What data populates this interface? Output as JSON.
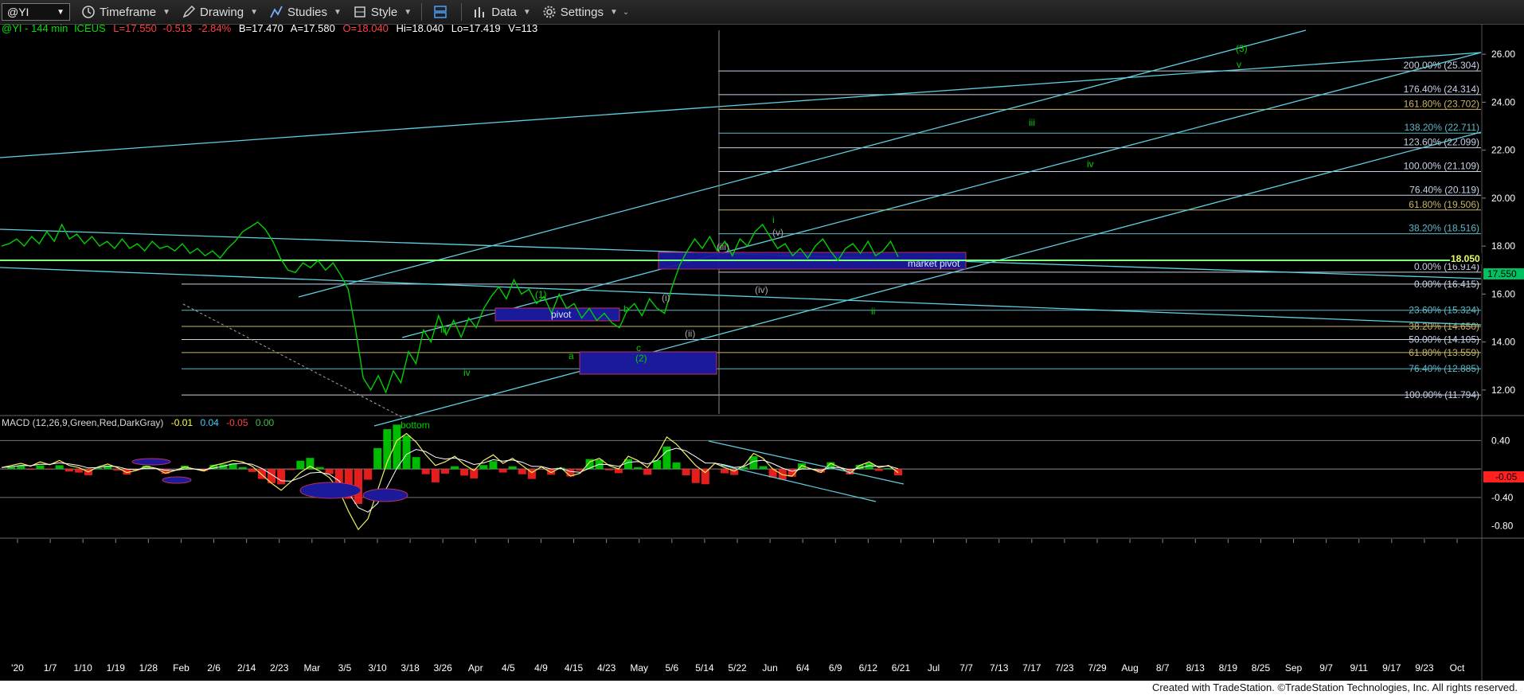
{
  "toolbar": {
    "symbol": "@YI",
    "timeframe_label": "Timeframe",
    "drawing_label": "Drawing",
    "studies_label": "Studies",
    "style_label": "Style",
    "data_label": "Data",
    "settings_label": "Settings"
  },
  "header": {
    "symbol": "@YI",
    "interval": "144 min",
    "exchange": "ICEUS",
    "last": "L=17.550",
    "change": "-0.513",
    "change_pct": "-2.84%",
    "bid": "B=17.470",
    "ask": "A=17.580",
    "open": "O=18.040",
    "high": "Hi=18.040",
    "low": "Lo=17.419",
    "volume": "V=113"
  },
  "macd_header": {
    "name": "MACD (12,26,9,Green,Red,DarkGray)",
    "v1": "-0.01",
    "v2": "0.04",
    "v3": "-0.05",
    "v4": "0.00"
  },
  "footer": "Created with TradeStation. ©TradeStation Technologies, Inc. All rights reserved.",
  "colors": {
    "up": "#00d000",
    "line": "#00ff00",
    "fib": "#cfd8e8",
    "channel": "#5fd0e0",
    "box": "#1a1a9a",
    "price_tag": "#00c060",
    "neg": "#ff2020"
  },
  "chart_data": {
    "type": "line",
    "price_axis": {
      "min": 11,
      "max": 27,
      "ticks": [
        "26.00",
        "24.00",
        "22.00",
        "20.00",
        "18.00",
        "16.00",
        "14.00",
        "12.00"
      ],
      "tick_values": [
        26,
        24,
        22,
        20,
        18,
        16,
        14,
        12
      ]
    },
    "macd_axis": {
      "ticks": [
        "0.40",
        "-0.40",
        "-0.80"
      ],
      "tick_values": [
        0.4,
        -0.4,
        -0.8
      ],
      "min": -0.95,
      "max": 0.55
    },
    "x_labels": [
      "'20",
      "1/7",
      "1/10",
      "1/19",
      "1/28",
      "Feb",
      "2/6",
      "2/14",
      "2/23",
      "Mar",
      "3/5",
      "3/10",
      "3/18",
      "3/26",
      "Apr",
      "4/5",
      "4/9",
      "4/15",
      "4/23",
      "May",
      "5/6",
      "5/14",
      "5/22",
      "Jun",
      "6/4",
      "6/9",
      "6/12",
      "6/21",
      "Jul",
      "7/7",
      "7/13",
      "7/17",
      "7/23",
      "7/29",
      "Aug",
      "8/7",
      "8/13",
      "8/19",
      "8/25",
      "Sep",
      "9/7",
      "9/11",
      "9/17",
      "9/23",
      "Oct"
    ],
    "price_tags": {
      "last": "17.550",
      "pivot_level": "18.050",
      "macd_last": "-0.05"
    },
    "price_series": {
      "name": "@YI",
      "values": [
        18.0,
        18.1,
        18.3,
        18.0,
        18.4,
        18.1,
        18.6,
        18.2,
        18.9,
        18.3,
        18.5,
        18.1,
        18.4,
        18.0,
        18.2,
        17.9,
        18.3,
        17.9,
        18.1,
        17.8,
        18.2,
        17.9,
        18.0,
        17.8,
        18.1,
        17.7,
        17.9,
        17.6,
        17.8,
        17.5,
        17.9,
        18.2,
        18.6,
        18.8,
        19.0,
        18.7,
        18.2,
        17.5,
        17.0,
        16.9,
        17.3,
        17.1,
        17.4,
        17.0,
        17.3,
        16.8,
        16.2,
        14.5,
        12.5,
        12.0,
        12.6,
        11.9,
        12.8,
        12.3,
        13.6,
        13.1,
        14.5,
        14.0,
        15.1,
        14.3,
        14.9,
        14.2,
        15.0,
        14.6,
        15.4,
        15.9,
        16.3,
        15.8,
        16.6,
        16.0,
        16.2,
        15.6,
        15.9,
        15.2,
        16.0,
        15.4,
        15.6,
        15.0,
        15.4,
        14.9,
        15.2,
        14.8,
        14.6,
        15.3,
        15.6,
        15.1,
        15.8,
        15.4,
        15.2,
        16.3,
        17.2,
        17.8,
        18.3,
        17.9,
        18.4,
        17.8,
        18.2,
        17.6,
        18.3,
        18.0,
        18.6,
        18.9,
        18.4,
        17.9,
        18.1,
        17.6,
        17.9,
        17.5,
        18.0,
        18.3,
        17.8,
        17.4,
        17.9,
        18.1,
        17.7,
        18.2,
        17.6,
        17.8,
        18.2,
        17.55
      ],
      "start": "2019-12-26",
      "end": "2020-06-24"
    },
    "macd_series": {
      "name": "MACD",
      "values": [
        0.02,
        0.05,
        0.08,
        0.04,
        0.1,
        0.06,
        0.12,
        0.05,
        0.02,
        -0.04,
        0.03,
        0.07,
        0.02,
        -0.05,
        -0.02,
        0.04,
        0.01,
        -0.06,
        -0.02,
        0.03,
        0.0,
        -0.03,
        0.05,
        0.08,
        0.12,
        0.1,
        0.04,
        -0.08,
        -0.2,
        -0.3,
        -0.18,
        -0.05,
        0.04,
        -0.03,
        -0.12,
        -0.3,
        -0.6,
        -0.85,
        -0.7,
        -0.3,
        0.1,
        0.4,
        0.5,
        0.38,
        0.2,
        0.05,
        0.1,
        0.18,
        0.06,
        -0.02,
        0.12,
        0.2,
        0.08,
        0.15,
        0.05,
        -0.05,
        0.03,
        -0.05,
        0.02,
        -0.1,
        -0.06,
        0.1,
        0.15,
        0.05,
        0.0,
        0.18,
        0.12,
        0.02,
        0.2,
        0.45,
        0.35,
        0.2,
        0.05,
        -0.05,
        0.08,
        0.02,
        -0.03,
        0.05,
        0.22,
        0.15,
        0.0,
        -0.08,
        -0.1,
        0.05,
        0.0,
        -0.05,
        0.08,
        0.02,
        -0.06,
        0.05,
        0.1,
        0.02,
        0.05,
        -0.05
      ]
    },
    "fib_right": [
      {
        "label": "200.00% (25.304)",
        "value": 25.304,
        "color": "#c8d2e6"
      },
      {
        "label": "176.40% (24.314)",
        "value": 24.314,
        "color": "#c8d2e6"
      },
      {
        "label": "161.80% (23.702)",
        "value": 23.702,
        "color": "#c8b468"
      },
      {
        "label": "138.20% (22.711)",
        "value": 22.711,
        "color": "#5fb8c8"
      },
      {
        "label": "123.60% (22.099)",
        "value": 22.099,
        "color": "#c8d2e6"
      },
      {
        "label": "100.00% (21.109)",
        "value": 21.109,
        "color": "#c8d2e6"
      },
      {
        "label": "76.40% (20.119)",
        "value": 20.119,
        "color": "#c8d2e6"
      },
      {
        "label": "61.80% (19.506)",
        "value": 19.506,
        "color": "#c8b468"
      },
      {
        "label": "38.20% (18.516)",
        "value": 18.516,
        "color": "#5fb8c8"
      },
      {
        "label": "0.00% (16.914)",
        "value": 16.914,
        "color": "#c8d2e6"
      }
    ],
    "fib_left": [
      {
        "label": "0.00% (16.415)",
        "value": 16.415,
        "color": "#c8d2e6"
      },
      {
        "label": "23.60% (15.324)",
        "value": 15.324,
        "color": "#5fb8c8"
      },
      {
        "label": "38.20% (14.650)",
        "value": 14.65,
        "color": "#c8b468"
      },
      {
        "label": "50.00% (14.105)",
        "value": 14.105,
        "color": "#c8d2e6"
      },
      {
        "label": "61.80% (13.559)",
        "value": 13.559,
        "color": "#c8b468"
      },
      {
        "label": "76.40% (12.885)",
        "value": 12.885,
        "color": "#5fb8c8"
      },
      {
        "label": "100.00% (11.794)",
        "value": 11.794,
        "color": "#c8d2e6"
      }
    ],
    "annotations": {
      "market_pivot": "market pivot",
      "pivot": "pivot",
      "bottom": "bottom",
      "labels": [
        "(3)",
        "v",
        "iii",
        "iv",
        "i",
        "(v)",
        "(iii)",
        "(iv)",
        "(i)",
        "(ii)",
        "(1)",
        "(2)",
        "a",
        "b",
        "c",
        "ii",
        "iii",
        "iv"
      ]
    }
  }
}
